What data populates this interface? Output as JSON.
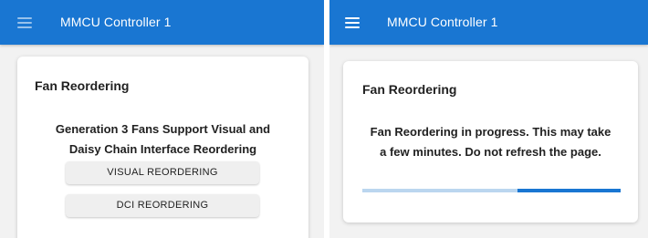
{
  "left_panel": {
    "app_title": "MMCU Controller 1",
    "card_title": "Fan Reordering",
    "message_lines": [
      "Generation 3 Fans Support Visual and",
      "Daisy Chain Interface Reordering"
    ],
    "visual_button_label": "VISUAL REORDERING",
    "dci_button_label": "DCI REORDERING"
  },
  "right_panel": {
    "app_title": "MMCU Controller 1",
    "card_title": "Fan Reordering",
    "message_lines": [
      "Fan Reordering in progress. This may take",
      "a few minutes. Do not refresh the page."
    ],
    "progress": {
      "type": "indeterminate",
      "visible_segment_start_fraction": 0.6,
      "visible_segment_end_fraction": 1.0
    }
  },
  "icons": {
    "menu": "hamburger-menu-icon"
  },
  "colors": {
    "app_bar": "#1976d2",
    "progress_bar": "#1976d2",
    "progress_track": "#bbd6ef",
    "card_background": "#ffffff",
    "page_background": "#f2f2f2",
    "button_background": "#efefef"
  }
}
